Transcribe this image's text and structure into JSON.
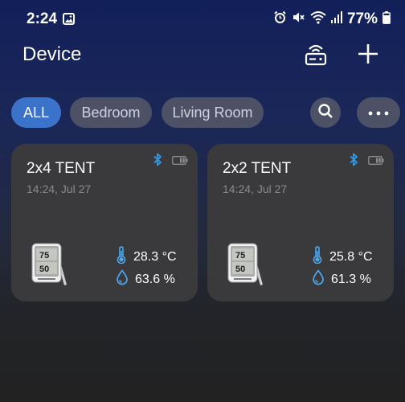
{
  "status_bar": {
    "time": "2:24",
    "battery_percent": "77%",
    "icons": [
      "image-icon",
      "alarm-icon",
      "mute-icon",
      "wifi-icon",
      "signal-icon",
      "battery-icon"
    ]
  },
  "header": {
    "title": "Device",
    "icons": [
      "gateway-hub-icon",
      "plus-icon"
    ]
  },
  "filters": {
    "chips": [
      {
        "label": "ALL",
        "active": true
      },
      {
        "label": "Bedroom",
        "active": false
      },
      {
        "label": "Living Room",
        "active": false
      }
    ],
    "icons": [
      "search-icon",
      "more-dots-icon"
    ]
  },
  "devices": [
    {
      "name": "2x4 TENT",
      "updated": "14:24, Jul 27",
      "temperature": "28.3 °C",
      "humidity": "63.6 %"
    },
    {
      "name": "2x2 TENT",
      "updated": "14:24, Jul 27",
      "temperature": "25.8 °C",
      "humidity": "61.3 %"
    }
  ],
  "colors": {
    "accent": "#3a73c9",
    "bluetooth": "#2f9be8",
    "sensor_icon": "#4aa8f0",
    "card_bg": "#3a3a3c"
  }
}
